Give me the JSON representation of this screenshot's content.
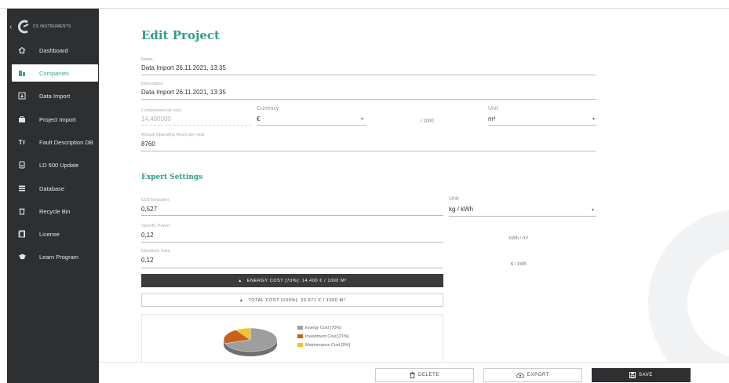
{
  "brand": {
    "name": "CS INSTRUMENTS"
  },
  "sidebar": {
    "items": [
      {
        "label": "Dashboard",
        "icon": "home-icon"
      },
      {
        "label": "Companies",
        "icon": "building-icon",
        "active": true
      },
      {
        "label": "Data Import",
        "icon": "import-icon"
      },
      {
        "label": "Project Import",
        "icon": "briefcase-icon"
      },
      {
        "label": "Fault Description DB",
        "icon": "text-format-icon"
      },
      {
        "label": "LD 500 Update",
        "icon": "device-icon"
      },
      {
        "label": "Database",
        "icon": "database-icon"
      },
      {
        "label": "Recycle Bin",
        "icon": "trash-icon"
      },
      {
        "label": "License",
        "icon": "license-icon"
      },
      {
        "label": "Learn Program",
        "icon": "graduation-cap-icon"
      }
    ]
  },
  "page": {
    "title": "Edit Project"
  },
  "form": {
    "name": {
      "label": "Name",
      "value": "Data Import  26.11.2021, 13:35"
    },
    "description": {
      "label": "Description",
      "value": "Data Import  26.11.2021, 13:35"
    },
    "compressed_air_cost": {
      "label": "Compressed air cost",
      "value": "14,400000"
    },
    "currency": {
      "label": "Currency",
      "value": "€"
    },
    "per": "/ 1000",
    "unit": {
      "label": "Unit",
      "value": "m³"
    },
    "operating_hours": {
      "label": "Annual Operating Hours per year",
      "value": "8760"
    }
  },
  "expert": {
    "title": "Expert Settings",
    "co2": {
      "label": "CO2 Emission",
      "value": "0,527"
    },
    "co2_unit": {
      "label": "Unit",
      "value": "kg / kWh"
    },
    "specific_power": {
      "label": "Specific Power",
      "value": "0,12",
      "unit": "kWh / m³"
    },
    "electricity_rate": {
      "label": "Electricity Rate",
      "value": "0,12",
      "unit": "€ / kWh"
    }
  },
  "cost_bars": {
    "energy": "ENERGY COST [70%]: 14.400 € / 1000 M³",
    "total": "TOTAL COST [100%]: 20.571 € / 1000 M³"
  },
  "chart_data": {
    "type": "pie",
    "categories": [
      "Energy Cost [70%]",
      "Investment Cost [21%]",
      "Maintenance Cost [9%]"
    ],
    "values": [
      70,
      21,
      9
    ],
    "colors": [
      "#9e9e9e",
      "#c8621b",
      "#f2c12e"
    ]
  },
  "footer": {
    "delete_label": "DELETE",
    "export_label": "EXPORT",
    "save_label": "SAVE"
  },
  "colors": {
    "accent": "#2f9e86",
    "sidebar": "#2e2f31"
  }
}
